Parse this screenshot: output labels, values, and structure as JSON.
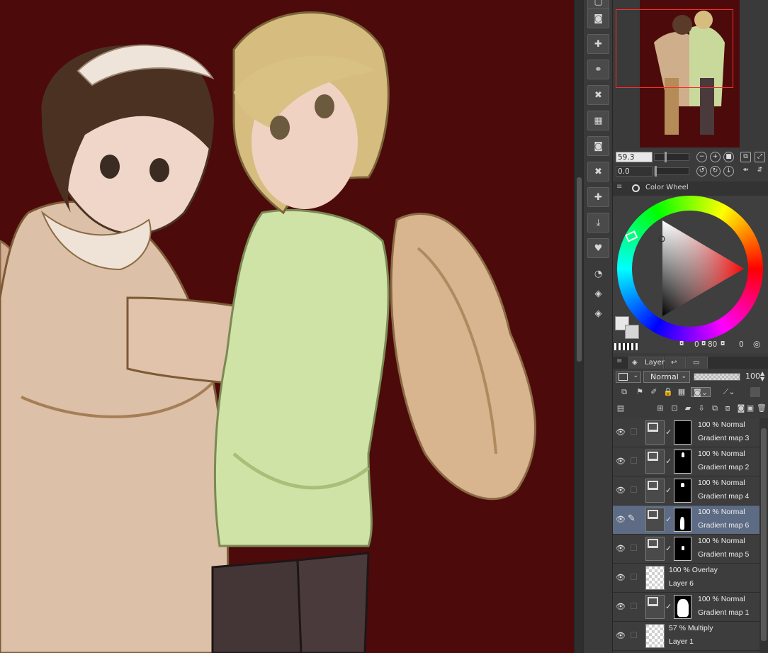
{
  "app": {
    "accent": "#5d6b84",
    "canvas_bg": "#4d0a0b"
  },
  "navigator": {
    "zoom_value": "59.3",
    "rotate_value": "0.0"
  },
  "color_wheel": {
    "title": "Color Wheel",
    "values": [
      "0",
      "80",
      "0"
    ],
    "fg_color": "#e8e8e8",
    "bg_color": "#d6d6d6"
  },
  "layer_panel": {
    "tab_label": "Layer",
    "blend_mode": "Normal",
    "opacity": "100",
    "layers": [
      {
        "mode": "100 % Normal",
        "name": "Gradient map 3",
        "kind": "gradient",
        "selected": false
      },
      {
        "mode": "100 % Normal",
        "name": "Gradient map 2",
        "kind": "gradient",
        "selected": false
      },
      {
        "mode": "100 % Normal",
        "name": "Gradient map 4",
        "kind": "gradient",
        "selected": false
      },
      {
        "mode": "100 % Normal",
        "name": "Gradient map 6",
        "kind": "gradient",
        "selected": true
      },
      {
        "mode": "100 % Normal",
        "name": "Gradient map 5",
        "kind": "gradient",
        "selected": false
      },
      {
        "mode": "100 % Overlay",
        "name": "Layer 6",
        "kind": "raster",
        "selected": false
      },
      {
        "mode": "100 % Normal",
        "name": "Gradient map 1",
        "kind": "gradient",
        "selected": false
      },
      {
        "mode": "57 % Multiply",
        "name": "Layer 1",
        "kind": "raster",
        "selected": false
      }
    ]
  }
}
